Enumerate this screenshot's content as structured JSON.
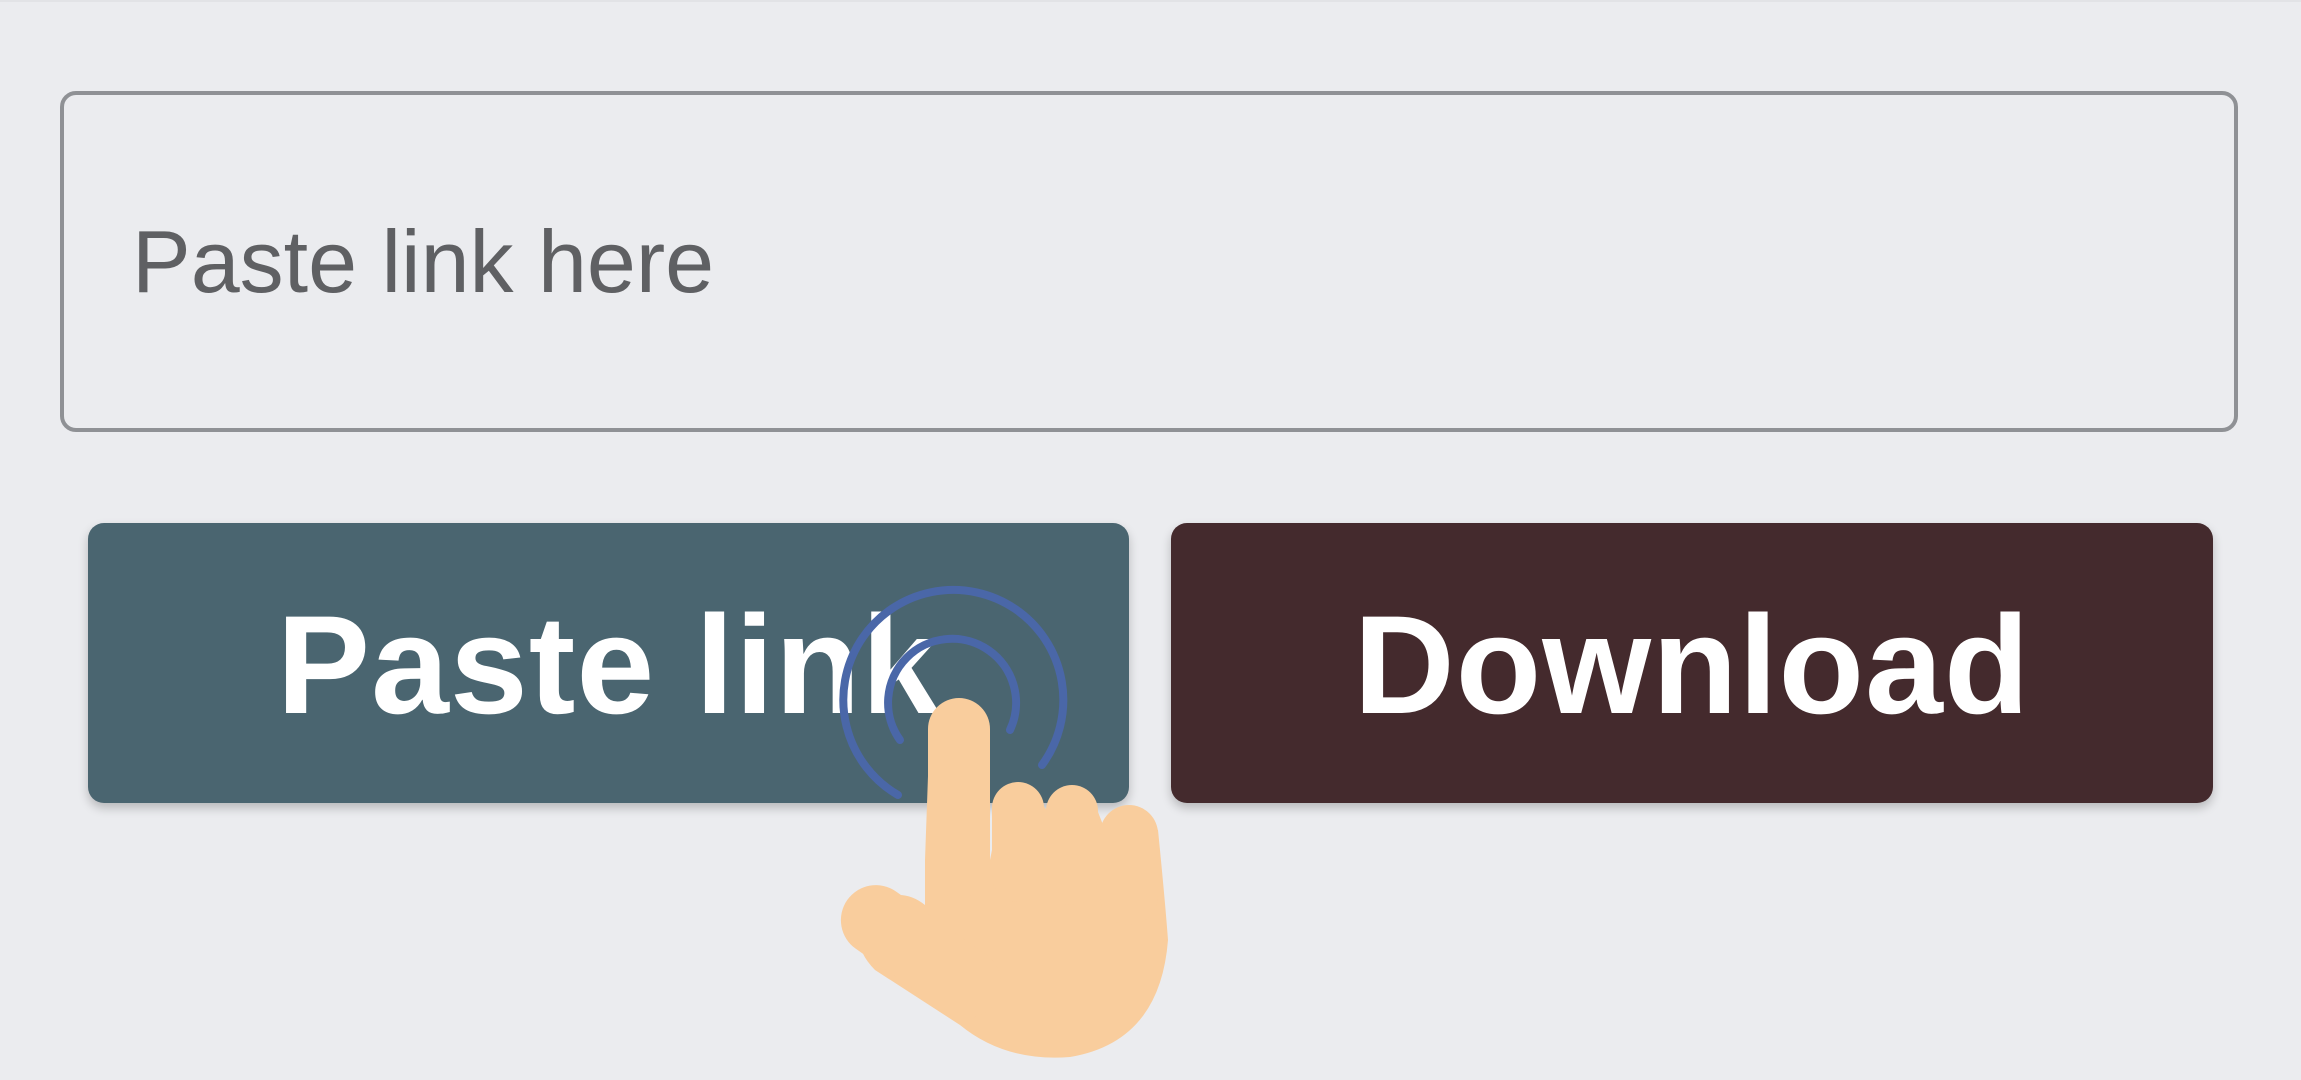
{
  "link_input": {
    "value": "",
    "placeholder": "Paste link here"
  },
  "buttons": {
    "paste_label": "Paste link",
    "download_label": "Download"
  },
  "icons": {
    "tap_indicator": "hand-tap-icon"
  },
  "colors": {
    "background": "#ebecef",
    "paste_button": "#4a6570",
    "download_button": "#442a2d",
    "input_border": "#8f9195",
    "placeholder_text": "#5f6063",
    "hand_skin": "#f9cd9d",
    "tap_ripple": "#4a67a8"
  }
}
